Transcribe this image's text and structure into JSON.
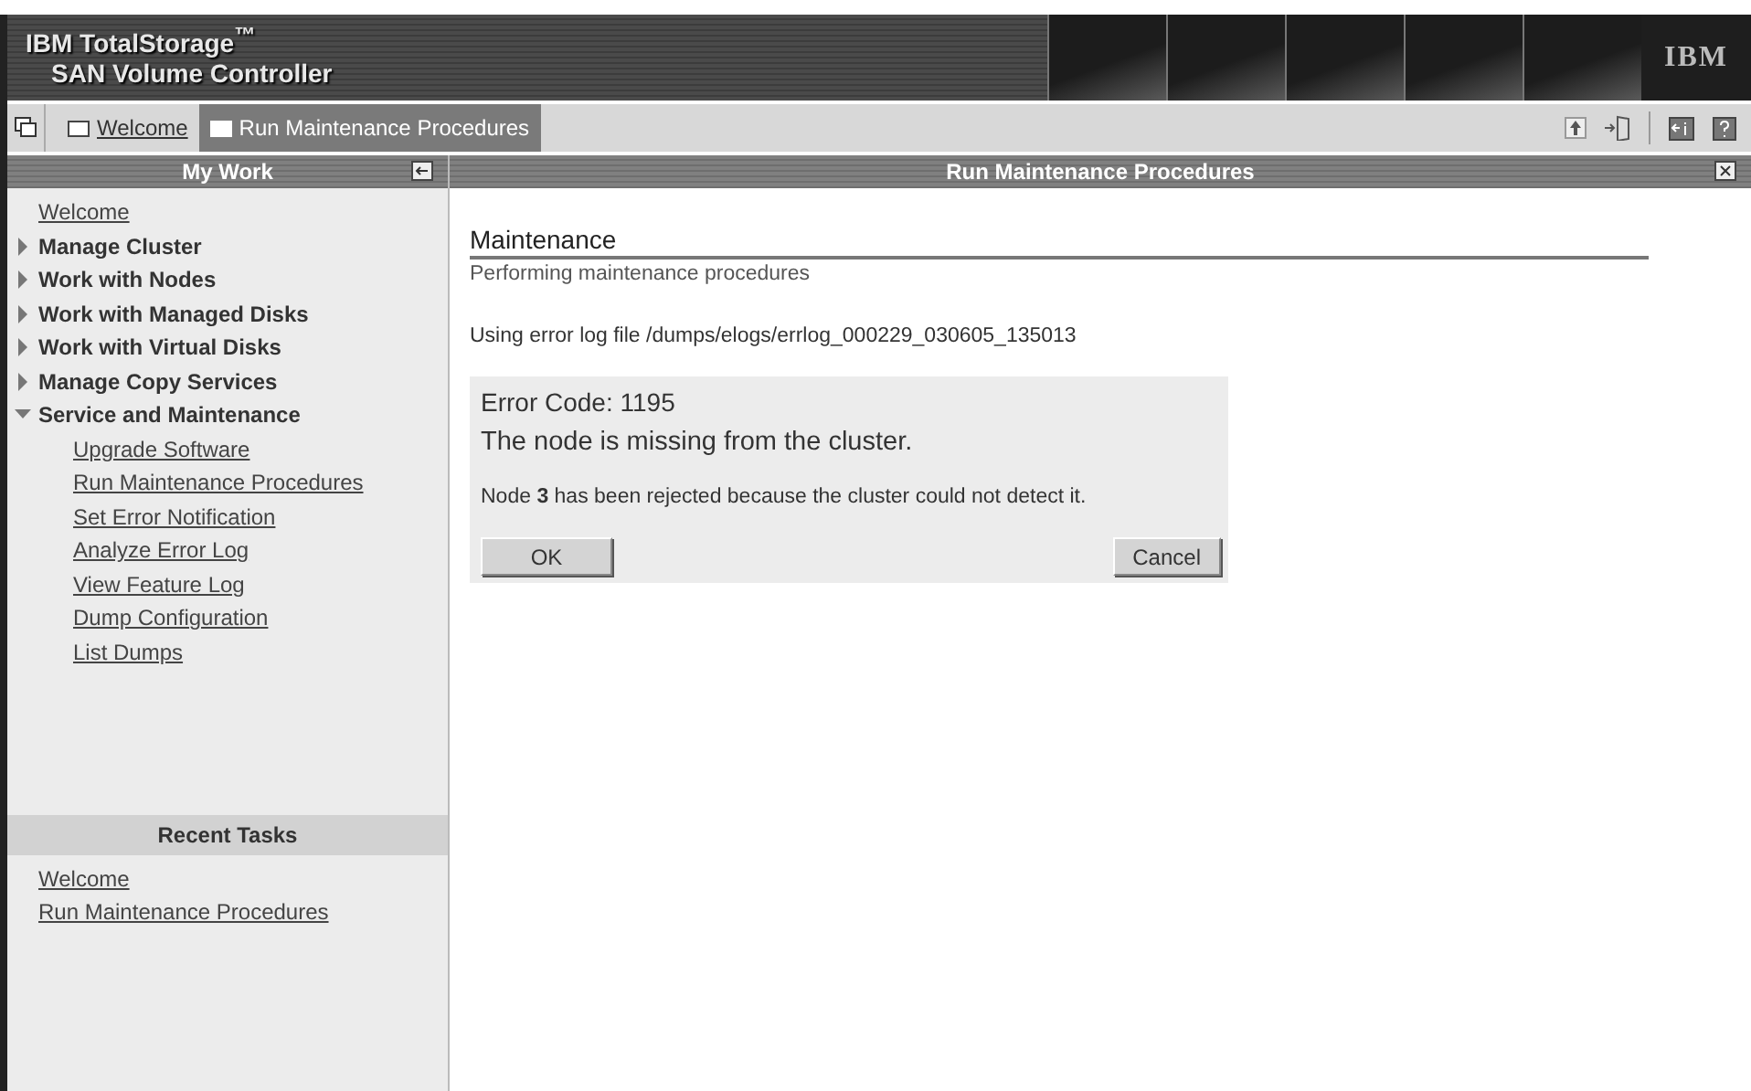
{
  "banner": {
    "title": "IBM TotalStorage$^{™}$",
    "subtitle": "SAN Volume Controller",
    "logo": "IBM"
  },
  "tabs": [
    {
      "label": "Welcome",
      "selected": false
    },
    {
      "label": "Run Maintenance Procedures",
      "selected": true
    }
  ],
  "sidebar": {
    "title": "My Work",
    "items": [
      {
        "kind": "link",
        "label": "Welcome"
      },
      {
        "kind": "group",
        "label": "Manage Cluster",
        "expanded": false
      },
      {
        "kind": "group",
        "label": "Work with Nodes",
        "expanded": false
      },
      {
        "kind": "group",
        "label": "Work with Managed Disks",
        "expanded": false
      },
      {
        "kind": "group",
        "label": "Work with Virtual Disks",
        "expanded": false
      },
      {
        "kind": "group",
        "label": "Manage Copy Services",
        "expanded": false
      },
      {
        "kind": "group",
        "label": "Service and Maintenance",
        "expanded": true,
        "children": [
          {
            "label": "Upgrade Software"
          },
          {
            "label": "Run Maintenance Procedures"
          },
          {
            "label": "Set Error Notification"
          },
          {
            "label": "Analyze Error Log"
          },
          {
            "label": "View Feature Log"
          },
          {
            "label": "Dump Configuration"
          },
          {
            "label": "List Dumps"
          }
        ]
      }
    ]
  },
  "recent_tasks": {
    "title": "Recent Tasks",
    "items": [
      "Welcome",
      "Run Maintenance Procedures"
    ]
  },
  "panel": {
    "title": "Run Maintenance Procedures",
    "heading": "Maintenance",
    "subtitle": "Performing maintenance procedures",
    "log_line": "Using error log file /dumps/elogs/errlog_000229_030605_135013",
    "error": {
      "code": "Error Code: 1195",
      "title": "The node is missing from the cluster.",
      "message": "Node **3** has been rejected because the cluster could not detect it."
    },
    "buttons": [
      "OK",
      "Cancel"
    ]
  }
}
